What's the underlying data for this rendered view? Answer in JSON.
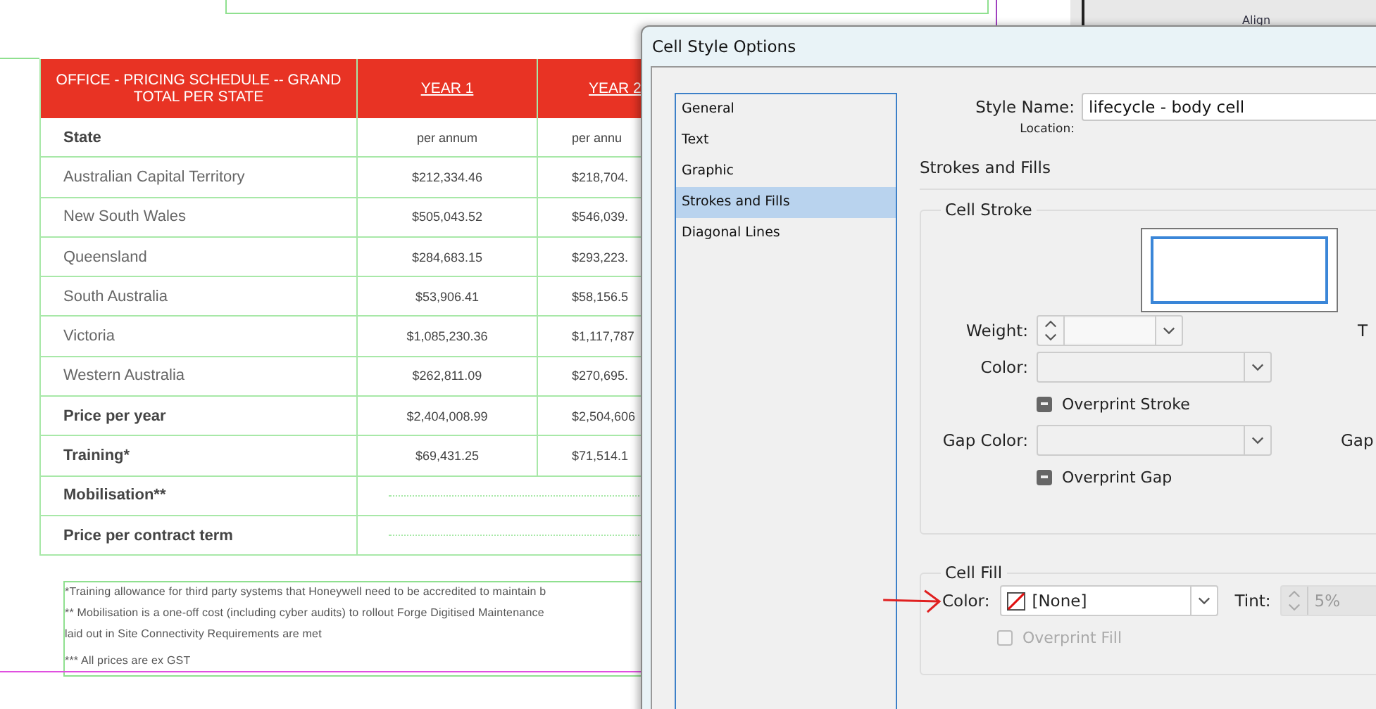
{
  "panel": {
    "label": "Align"
  },
  "table": {
    "columns": [
      "OFFICE - PRICING SCHEDULE -- GRAND TOTAL PER STATE",
      "YEAR 1",
      "YEAR 2"
    ],
    "rows": [
      {
        "kind": "subheader",
        "cells": [
          "State",
          "per annum",
          "per annu"
        ]
      },
      {
        "kind": "body",
        "cells": [
          "Australian Capital Territory",
          "$212,334.46",
          "$218,704."
        ]
      },
      {
        "kind": "body",
        "cells": [
          "New South Wales",
          "$505,043.52",
          "$546,039."
        ]
      },
      {
        "kind": "body",
        "cells": [
          "Queensland",
          "$284,683.15",
          "$293,223."
        ]
      },
      {
        "kind": "body",
        "cells": [
          "South Australia",
          "$53,906.41",
          "$58,156.5"
        ]
      },
      {
        "kind": "body",
        "cells": [
          "Victoria",
          "$1,085,230.36",
          "$1,117,787"
        ]
      },
      {
        "kind": "body",
        "cells": [
          "Western Australia",
          "$262,811.09",
          "$270,695."
        ]
      },
      {
        "kind": "total",
        "cells": [
          "Price per year",
          "$2,404,008.99",
          "$2,504,606"
        ]
      },
      {
        "kind": "total",
        "cells": [
          "Training*",
          "$69,431.25",
          "$71,514.1"
        ]
      },
      {
        "kind": "merged",
        "cells": [
          "Mobilisation**"
        ]
      },
      {
        "kind": "merged",
        "cells": [
          "Price per contract term"
        ]
      }
    ]
  },
  "footnotes": [
    "*Training allowance for third party systems that Honeywell need to be accredited to maintain b",
    "** Mobilisation is a one-off cost (including cyber audits) to rollout Forge Digitised Maintenance",
    "laid out in Site Connectivity Requirements are met",
    "*** All prices are ex GST"
  ],
  "dialog": {
    "title": "Cell Style Options",
    "nav": [
      {
        "label": "General",
        "selected": false
      },
      {
        "label": "Text",
        "selected": false
      },
      {
        "label": "Graphic",
        "selected": false
      },
      {
        "label": "Strokes and Fills",
        "selected": true
      },
      {
        "label": "Diagonal Lines",
        "selected": false
      }
    ],
    "style_name": {
      "label": "Style Name:",
      "value": "lifecycle - body cell"
    },
    "location": {
      "label": "Location:"
    },
    "section_title": "Strokes and Fills",
    "cell_stroke": {
      "legend": "Cell Stroke",
      "weight_label": "Weight:",
      "color_label": "Color:",
      "overprint_stroke": {
        "label": "Overprint Stroke",
        "mixed": true,
        "disabled": false
      },
      "gap_color_label": "Gap Color:",
      "overprint_gap": {
        "label": "Overprint Gap",
        "mixed": true,
        "disabled": false
      },
      "right_label_1": "T",
      "right_label_2": "Gap"
    },
    "cell_fill": {
      "legend": "Cell Fill",
      "color_label": "Color:",
      "color_value": "[None]",
      "tint_label": "Tint:",
      "tint_value": "5%",
      "overprint_fill": {
        "label": "Overprint Fill",
        "checked": false,
        "disabled": true
      }
    }
  }
}
